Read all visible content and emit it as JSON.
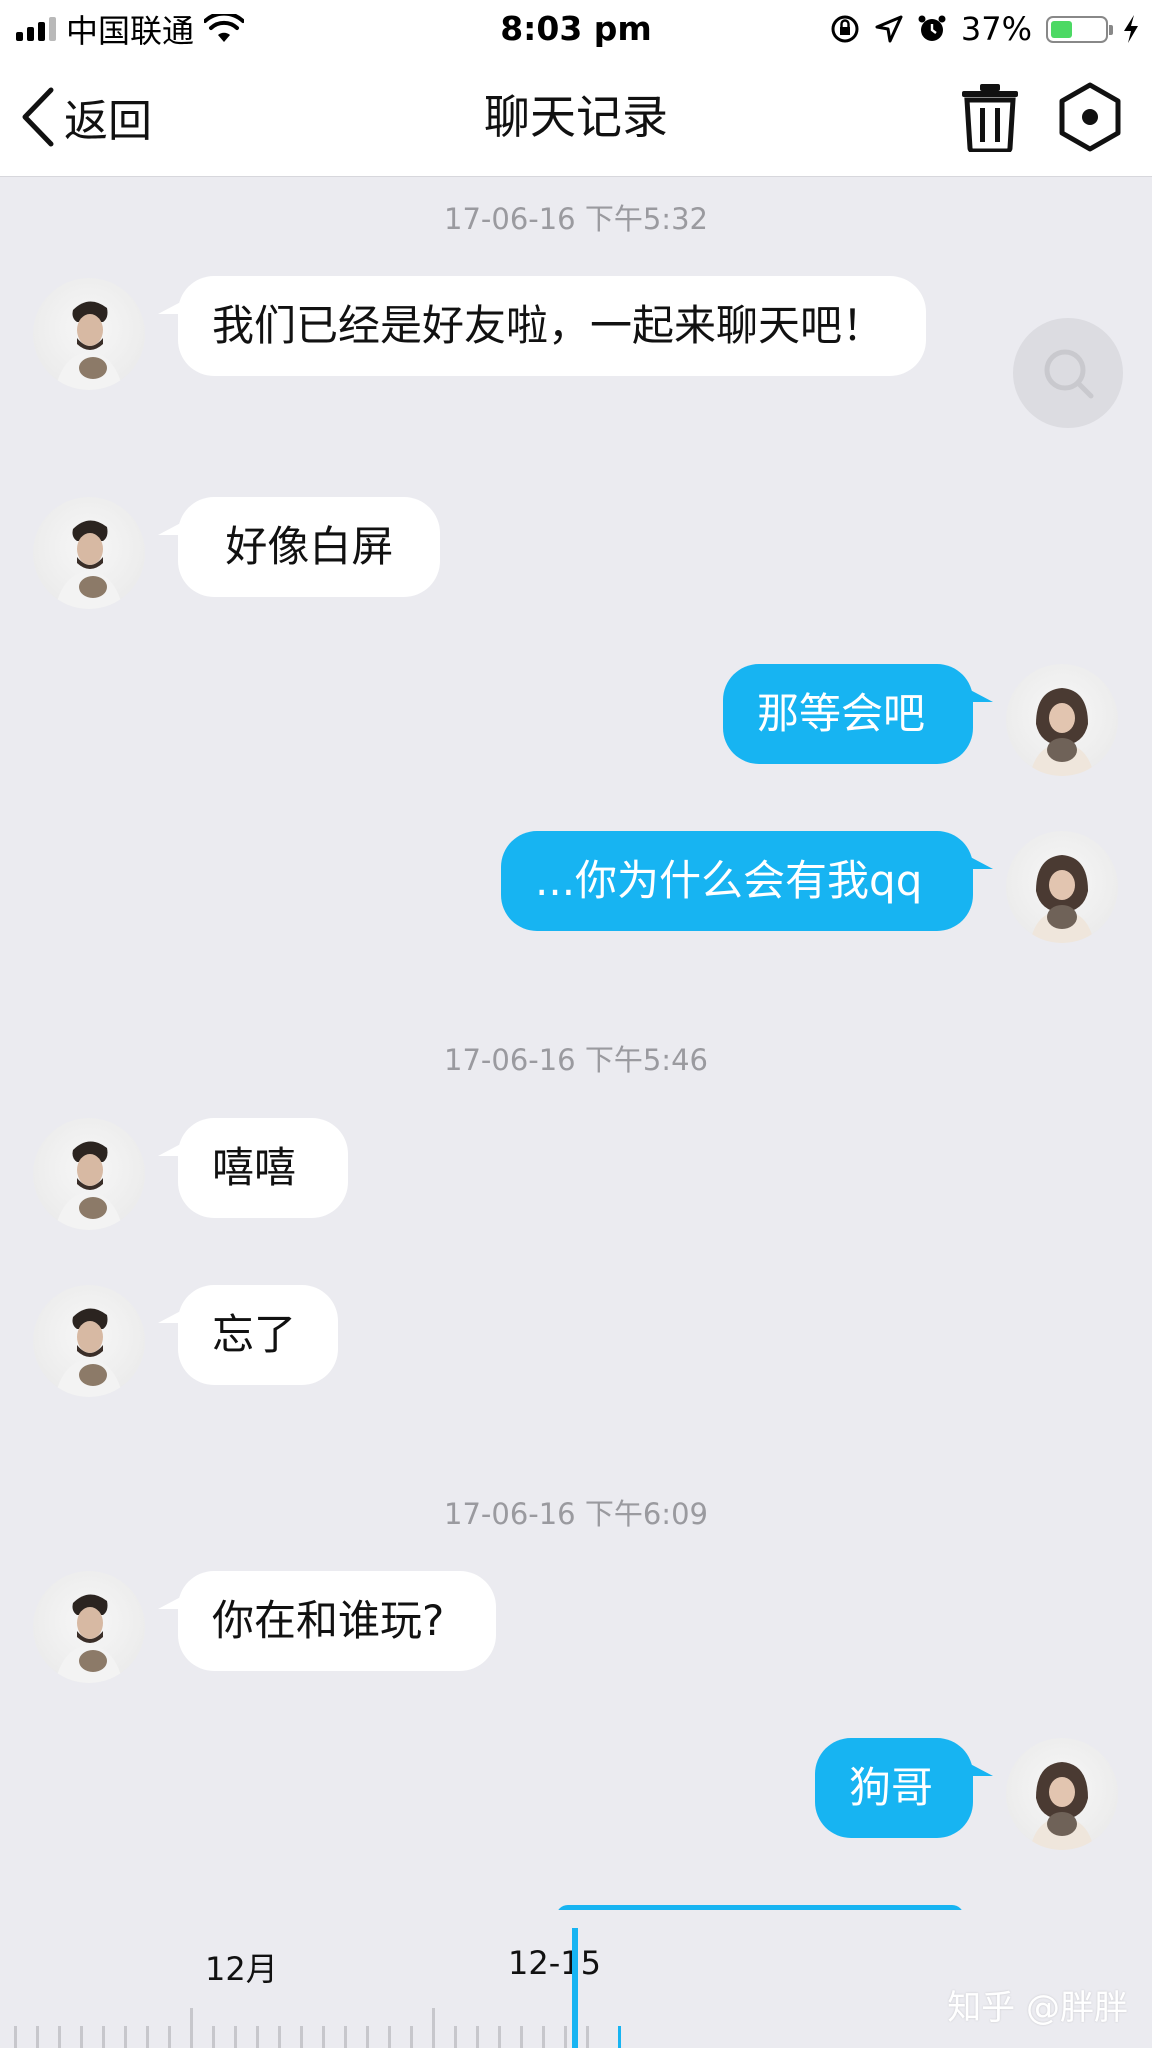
{
  "status_bar": {
    "carrier": "中国联通",
    "time": "8:03 pm",
    "battery": "37%"
  },
  "nav": {
    "back_label": "返回",
    "title": "聊天记录"
  },
  "messages": [
    {
      "type": "timestamp",
      "text": "17-06-16 下午5:32"
    },
    {
      "type": "in",
      "text": "我们已经是好友啦，一起来聊天吧！"
    },
    {
      "type": "in",
      "text": " 好像白屏"
    },
    {
      "type": "out",
      "text": "那等会吧"
    },
    {
      "type": "out",
      "text": "...你为什么会有我qq"
    },
    {
      "type": "timestamp",
      "text": "17-06-16 下午5:46"
    },
    {
      "type": "in",
      "text": "嘻嘻"
    },
    {
      "type": "in",
      "text": "忘了"
    },
    {
      "type": "timestamp",
      "text": "17-06-16 下午6:09"
    },
    {
      "type": "in",
      "text": "你在和谁玩?"
    },
    {
      "type": "out",
      "text": "狗哥"
    }
  ],
  "timeline": {
    "label_month": "12月",
    "label_day": "12-15",
    "watermark": "知乎 @胖胖"
  },
  "colors": {
    "accent": "#17b4f2",
    "background": "#ebebf0",
    "incoming_bubble": "#ffffff"
  },
  "icons": [
    "back-chevron-icon",
    "trash-icon",
    "settings-hexagon-icon",
    "search-icon",
    "wifi-icon",
    "location-icon",
    "alarm-icon",
    "charging-icon"
  ]
}
